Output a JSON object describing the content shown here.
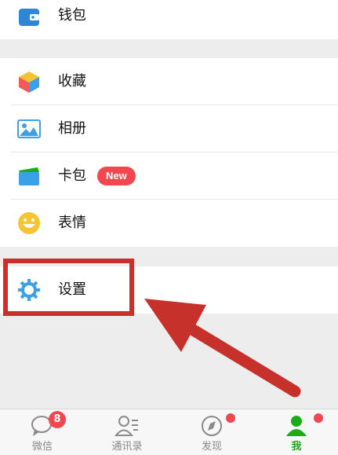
{
  "menu": {
    "wallet_label": "钱包",
    "favorites_label": "收藏",
    "album_label": "相册",
    "cards_label": "卡包",
    "cards_badge": "New",
    "stickers_label": "表情",
    "settings_label": "设置"
  },
  "tabbar": {
    "tabs": [
      {
        "label": "微信",
        "badge": "8"
      },
      {
        "label": "通讯录"
      },
      {
        "label": "发现"
      },
      {
        "label": "我"
      }
    ]
  },
  "colors": {
    "accent_green": "#1aad19",
    "badge_red": "#f2474f",
    "annotation_red": "#c7312b"
  }
}
